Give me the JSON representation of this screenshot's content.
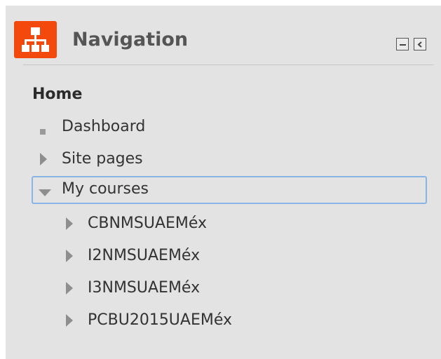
{
  "block": {
    "title": "Navigation",
    "icon": "sitemap-icon",
    "accent_color": "#f3490d",
    "controls": {
      "hide_icon": "minus-icon",
      "dock_icon": "dock-left-icon"
    }
  },
  "nav": {
    "home_label": "Home",
    "items": [
      {
        "label": "Dashboard",
        "icon": "square-bullet-icon"
      },
      {
        "label": "Site pages",
        "icon": "triangle-right-icon"
      },
      {
        "label": "My courses",
        "icon": "triangle-down-icon",
        "focused": true
      }
    ],
    "courses": [
      {
        "label": "CBNMSUAEMéx",
        "icon": "triangle-right-icon"
      },
      {
        "label": "I2NMSUAEMéx",
        "icon": "triangle-right-icon"
      },
      {
        "label": "I3NMSUAEMéx",
        "icon": "triangle-right-icon"
      },
      {
        "label": "PCBU2015UAEMéx",
        "icon": "triangle-right-icon"
      }
    ]
  },
  "colors": {
    "block_background": "#e3e3e3",
    "focus_border": "#8ab4e6"
  }
}
